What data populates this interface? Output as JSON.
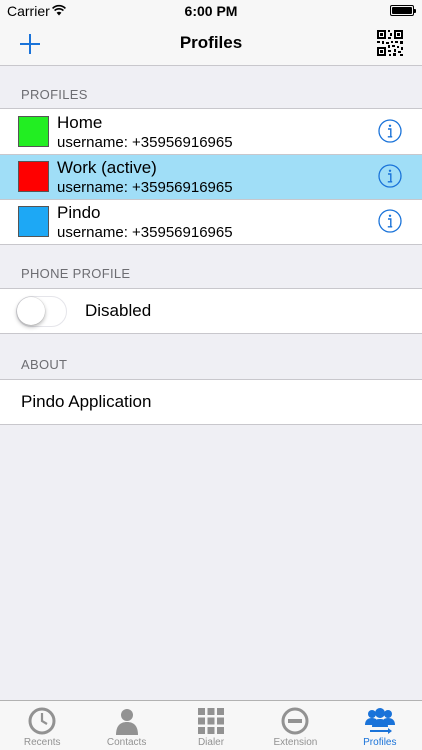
{
  "status_bar": {
    "carrier": "Carrier",
    "time": "6:00 PM"
  },
  "nav": {
    "title": "Profiles",
    "add_icon": "plus-icon",
    "qr_icon": "qr-code-icon",
    "accent": "#1a73d9"
  },
  "profiles_section": {
    "header": "PROFILES",
    "items": [
      {
        "name": "Home",
        "username": "username: +35956916965",
        "color": "#22ee22",
        "active": false
      },
      {
        "name": "Work (active)",
        "username": "username: +35956916965",
        "color": "#ff0000",
        "active": true
      },
      {
        "name": "Pindo",
        "username": "username: +35956916965",
        "color": "#1da8f5",
        "active": false
      }
    ]
  },
  "phone_profile_section": {
    "header": "PHONE PROFILE",
    "toggle_label": "Disabled",
    "toggle_on": false
  },
  "about_section": {
    "header": "ABOUT",
    "item_label": "Pindo Application"
  },
  "tab_bar": {
    "tabs": [
      {
        "label": "Recents",
        "icon": "clock-icon",
        "selected": false
      },
      {
        "label": "Contacts",
        "icon": "person-icon",
        "selected": false
      },
      {
        "label": "Dialer",
        "icon": "keypad-icon",
        "selected": false
      },
      {
        "label": "Extension",
        "icon": "minus-circle-icon",
        "selected": false
      },
      {
        "label": "Profiles",
        "icon": "profiles-icon",
        "selected": true
      }
    ]
  }
}
